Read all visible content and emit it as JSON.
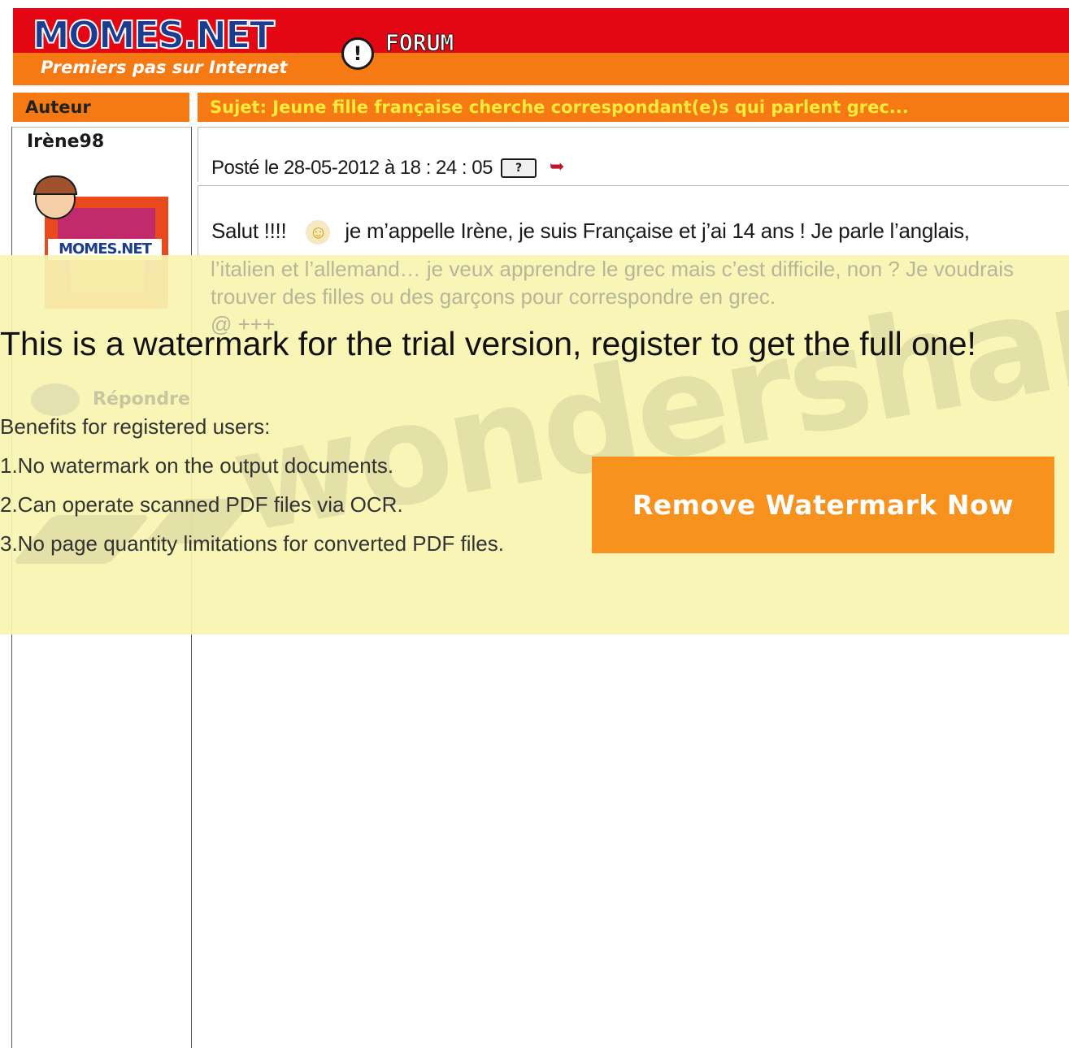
{
  "header": {
    "logo": "MOMES.NET",
    "tagline": "Premiers pas sur Internet",
    "section": "FORUM"
  },
  "columns": {
    "author": "Auteur",
    "subject": "Sujet: Jeune fille française cherche correspondant(e)s qui parlent grec..."
  },
  "post": {
    "username": "Irène98",
    "avatar_logo": "MOMES.NET",
    "posted": "Posté le 28-05-2012 à 18 : 24 : 05",
    "line1_start": "Salut !!!!",
    "line1_end": "je m’appelle Irène, je suis Française et j’ai 14 ans ! Je parle l’anglais,",
    "line2": "l’italien et l’allemand… je veux apprendre le grec mais c’est difficile, non ? Je voudrais",
    "line3": "trouver des filles ou des garçons pour correspondre en grec.",
    "line4": "@ +++",
    "reply": "Répondre"
  },
  "watermark": {
    "brand": "wondershare",
    "title": "This is a watermark for the trial version, register to get the full one!",
    "benefits_heading": "Benefits for registered users:",
    "items": [
      "1.No watermark on the output documents.",
      "2.Can operate scanned PDF files via OCR.",
      "3.No page quantity limitations for converted PDF files."
    ],
    "button": "Remove Watermark Now"
  },
  "icons": {
    "forum": "exclamation-bubble-icon",
    "smiley": "smiley-icon",
    "profile": "profile-card-icon",
    "message": "send-message-icon",
    "reply": "speech-bubble-icon"
  },
  "colors": {
    "header_red": "#e30613",
    "header_orange": "#f57a14",
    "subject_text": "#ffeb3b",
    "watermark_bg": "#f7f4b2",
    "watermark_button": "#f7921e"
  }
}
